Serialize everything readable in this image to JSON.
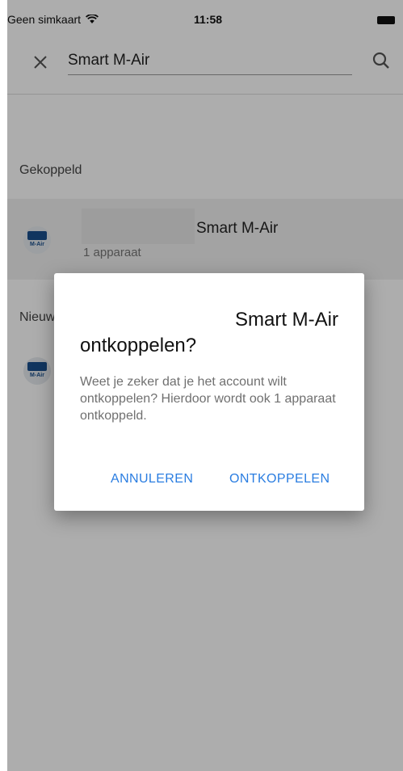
{
  "status_bar": {
    "carrier": "Geen simkaart",
    "time": "11:58"
  },
  "search": {
    "query": "Smart M-Air"
  },
  "sections": {
    "linked": "Gekoppeld",
    "new": "Nieuw"
  },
  "linked_item": {
    "name": "Smart M-Air",
    "count": "1 apparaat",
    "logo_text": "M-Air"
  },
  "new_item": {
    "logo_text": "M-Air"
  },
  "dialog": {
    "title_name": "Smart M-Air",
    "title_rest": "ontkoppelen?",
    "body": "Weet je zeker dat je het account wilt ontkoppelen? Hierdoor wordt ook 1 apparaat ontkoppeld.",
    "cancel": "ANNULEREN",
    "confirm": "ONTKOPPELEN"
  },
  "colors": {
    "accent": "#2a7de1",
    "brand": "#1a4f8c"
  }
}
